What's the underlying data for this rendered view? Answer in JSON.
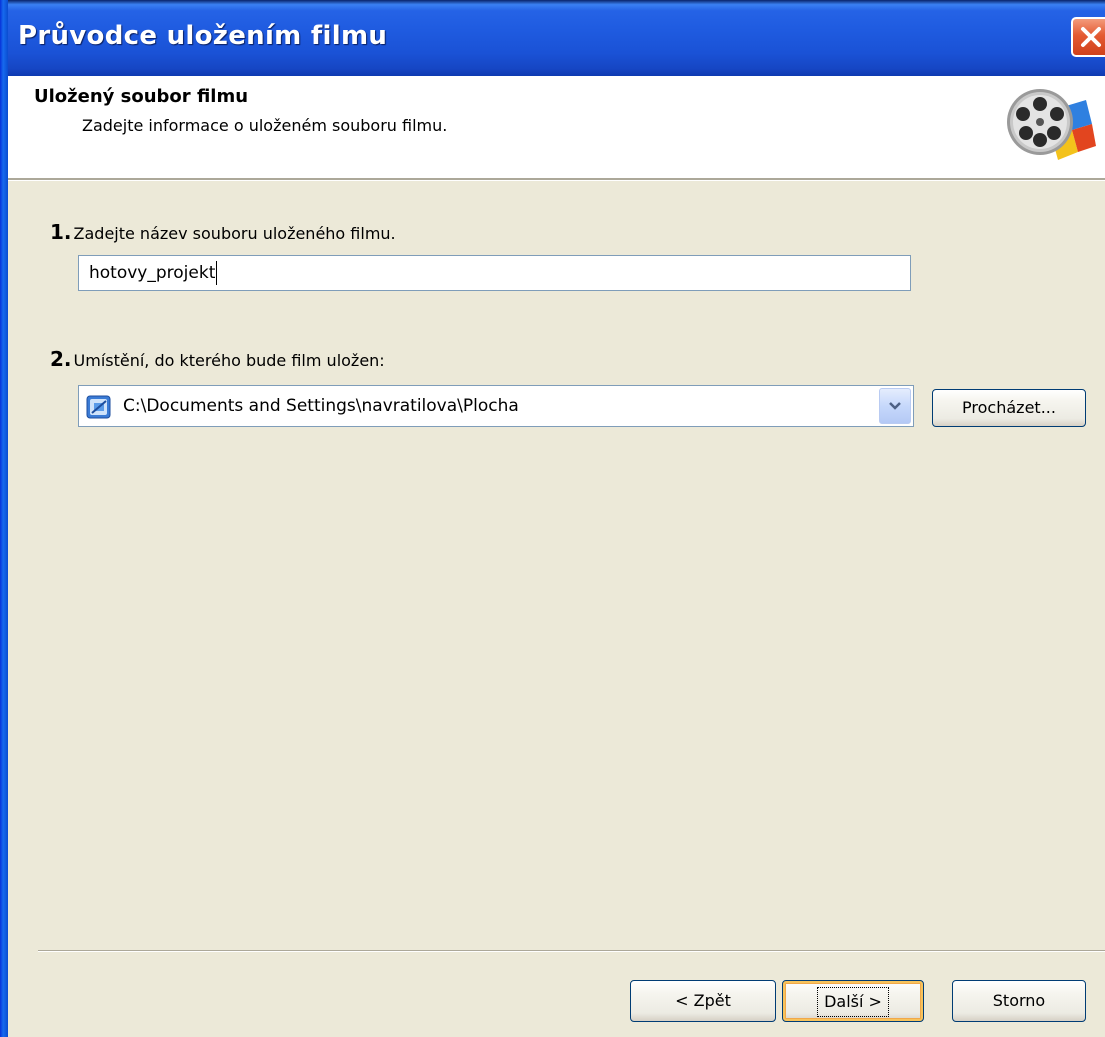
{
  "window": {
    "title": "Průvodce uložením filmu"
  },
  "header": {
    "title": "Uložený soubor filmu",
    "subtitle": "Zadejte informace o uloženém souboru filmu.",
    "icon": "movie-maker-film-reel-icon"
  },
  "step1": {
    "number": "1.",
    "label": "Zadejte název souboru uloženého filmu.",
    "filename_value": "hotovy_projekt"
  },
  "step2": {
    "number": "2.",
    "label": "Umístění, do kterého bude  film uložen:",
    "location_value": "C:\\Documents and Settings\\navratilova\\Plocha",
    "location_icon": "desktop-folder-icon",
    "browse_label": "Procházet..."
  },
  "footer": {
    "back_label": "< Zpět",
    "next_label": "Další >",
    "cancel_label": "Storno"
  },
  "colors": {
    "titlebar": "#1F5BE0",
    "dialog_bg": "#ECE9D8",
    "close_button": "#E45A33",
    "default_button_highlight": "#F7C35B"
  }
}
